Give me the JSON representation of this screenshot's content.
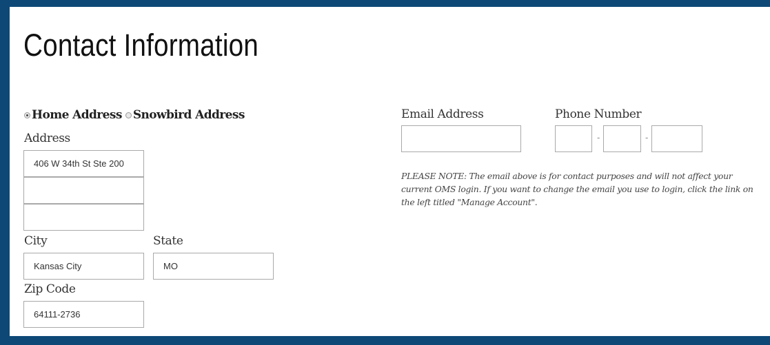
{
  "page": {
    "title": "Contact Information"
  },
  "address_type": {
    "options": [
      {
        "label": "Home Address",
        "checked": true
      },
      {
        "label": "Snowbird Address",
        "checked": false
      }
    ]
  },
  "address": {
    "label": "Address",
    "line1": "406 W 34th St Ste 200",
    "line2": "",
    "line3": ""
  },
  "city": {
    "label": "City",
    "value": "Kansas City"
  },
  "state": {
    "label": "State",
    "value": "MO"
  },
  "zip": {
    "label": "Zip Code",
    "value": "64111-2736"
  },
  "email": {
    "label": "Email Address",
    "value": ""
  },
  "phone": {
    "label": "Phone Number",
    "area": "",
    "prefix": "",
    "line": "",
    "separator": "-"
  },
  "note": "PLEASE NOTE: The email above is for contact purposes and will not affect your current OMS login. If you want to change the email you use to login, click the link on the left titled \"Manage Account\".",
  "colors": {
    "frame": "#0d4877",
    "background": "#ffffff"
  }
}
